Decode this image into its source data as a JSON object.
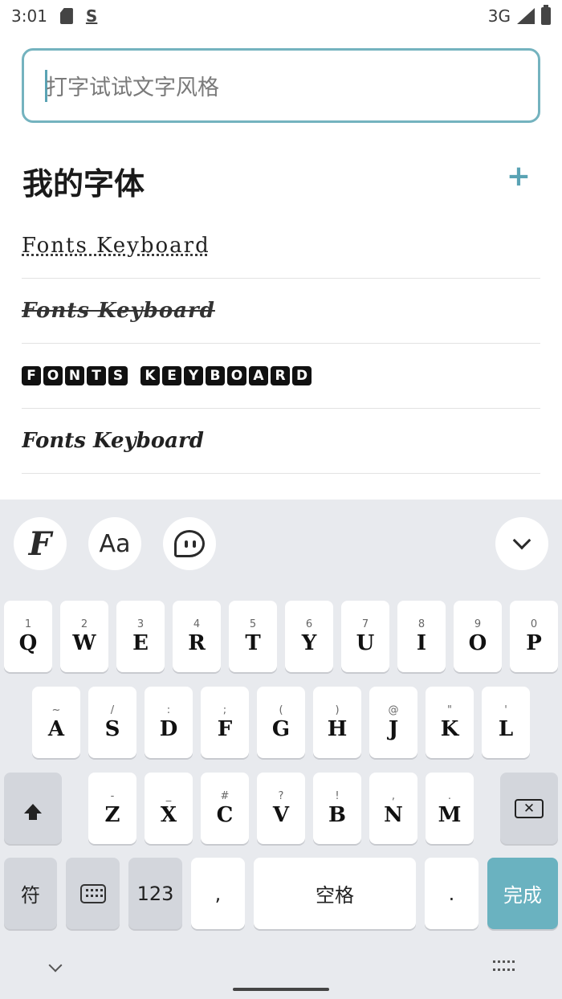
{
  "status_bar": {
    "time": "3:01",
    "network": "3G",
    "sync_letter": "S"
  },
  "input": {
    "placeholder": "打字试试文字风格"
  },
  "section": {
    "title": "我的字体",
    "add_label": "+"
  },
  "font_samples": [
    {
      "style": "dotted-outline",
      "text": "Fonts Keyboard"
    },
    {
      "style": "script-strike",
      "text": "Fonts Keyboard"
    },
    {
      "style": "boxed",
      "letters": [
        "F",
        "O",
        "N",
        "T",
        "S",
        " ",
        "K",
        "E",
        "Y",
        "B",
        "O",
        "A",
        "R",
        "D"
      ]
    },
    {
      "style": "blackletter",
      "text": "Fonts Keyboard"
    }
  ],
  "toolbar": {
    "fonts_glyph": "F",
    "textcase_label": "Aa"
  },
  "keyboard": {
    "row1": [
      {
        "hint": "1",
        "char": "Q"
      },
      {
        "hint": "2",
        "char": "W"
      },
      {
        "hint": "3",
        "char": "E"
      },
      {
        "hint": "4",
        "char": "R"
      },
      {
        "hint": "5",
        "char": "T"
      },
      {
        "hint": "6",
        "char": "Y"
      },
      {
        "hint": "7",
        "char": "U"
      },
      {
        "hint": "8",
        "char": "I"
      },
      {
        "hint": "9",
        "char": "O"
      },
      {
        "hint": "0",
        "char": "P"
      }
    ],
    "row2": [
      {
        "hint": "~",
        "char": "A"
      },
      {
        "hint": "/",
        "char": "S"
      },
      {
        "hint": ":",
        "char": "D"
      },
      {
        "hint": ";",
        "char": "F"
      },
      {
        "hint": "(",
        "char": "G"
      },
      {
        "hint": ")",
        "char": "H"
      },
      {
        "hint": "@",
        "char": "J"
      },
      {
        "hint": "\"",
        "char": "K"
      },
      {
        "hint": "'",
        "char": "L"
      }
    ],
    "row3": [
      {
        "hint": "-",
        "char": "Z"
      },
      {
        "hint": "_",
        "char": "X"
      },
      {
        "hint": "#",
        "char": "C"
      },
      {
        "hint": "?",
        "char": "V"
      },
      {
        "hint": "!",
        "char": "B"
      },
      {
        "hint": ",",
        "char": "N"
      },
      {
        "hint": ".",
        "char": "M"
      }
    ],
    "symbols_label": "符",
    "numbers_label": "123",
    "comma_label": ",",
    "space_label": "空格",
    "period_label": ".",
    "done_label": "完成"
  },
  "colors": {
    "accent": "#6ab2c0",
    "input_border": "#74b3bf",
    "keyboard_bg": "#e8eaee"
  }
}
